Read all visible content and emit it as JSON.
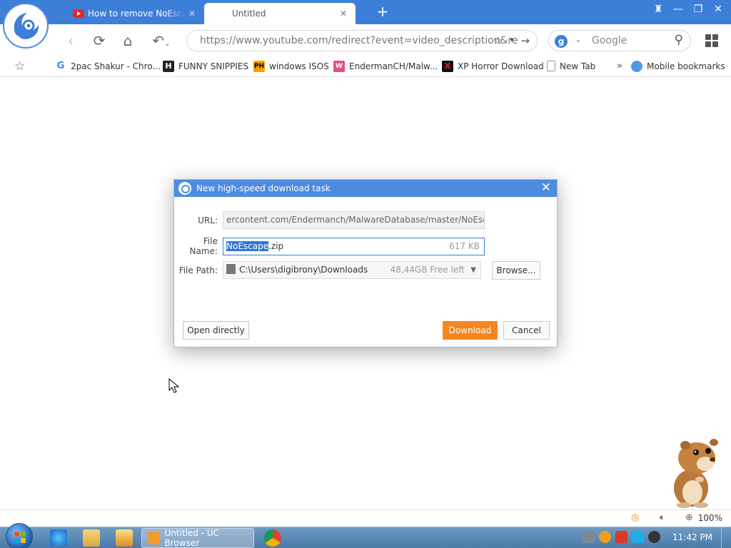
{
  "browser": {
    "tabs": [
      {
        "label": "How to remove NoEscape.zip",
        "close": "✕",
        "active": false
      },
      {
        "label": "Untitled",
        "close": "✕",
        "active": true
      }
    ],
    "new_tab": "+",
    "address_url": "https://www.youtube.com/redirect?event=video_description&re",
    "search_engine_letter": "g",
    "search_placeholder": "Google",
    "bookmarks": [
      {
        "label": "2pac Shakur - Chro...",
        "icon": "google-icon"
      },
      {
        "label": "FUNNY SNIPPIES",
        "icon": "h-icon"
      },
      {
        "label": "windows ISOS",
        "icon": "ph-icon"
      },
      {
        "label": "EndermanCH/Malw...",
        "icon": "wp-icon"
      },
      {
        "label": "XP Horror Download",
        "icon": "x-icon"
      },
      {
        "label": "New Tab",
        "icon": "page-icon"
      }
    ],
    "bookmarks_more": "»",
    "mobile_bookmarks": "Mobile bookmarks"
  },
  "dialog": {
    "title": "New high-speed download task",
    "url_label": "URL:",
    "url_value": "ercontent.com/Endermanch/MalwareDatabase/master/NoEscape.zip",
    "filename_label": "File Name:",
    "filename_selected": "NoEscape",
    "filename_rest": ".zip",
    "file_size": "617 KB",
    "filepath_label": "File Path:",
    "filepath_value": "C:\\Users\\digibrony\\Downloads",
    "free_space": "48,44GB Free left",
    "browse_label": "Browse...",
    "open_directly_label": "Open directly",
    "download_label": "Download",
    "cancel_label": "Cancel"
  },
  "statusbar": {
    "zoom": "100%"
  },
  "taskbar": {
    "active_app_label": "Untitled - UC Browser",
    "clock": "11:42 PM"
  },
  "colors": {
    "brand_blue": "#3c7ed8",
    "dialog_title": "#4d8ce0",
    "download_button": "#f7861e"
  }
}
